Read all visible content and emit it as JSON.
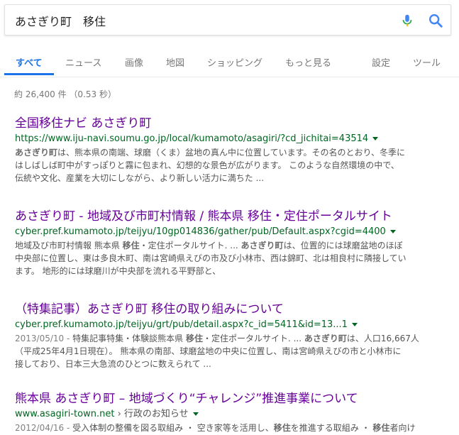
{
  "search": {
    "query": "あさぎり町　移住"
  },
  "tabs": [
    {
      "label": "すべて"
    },
    {
      "label": "ニュース"
    },
    {
      "label": "画像"
    },
    {
      "label": "地図"
    },
    {
      "label": "ショッピング"
    },
    {
      "label": "もっと見る"
    },
    {
      "label": "設定"
    },
    {
      "label": "ツール"
    }
  ],
  "stats": "約 26,400 件 （0.53 秒）",
  "results": [
    {
      "title": "全国移住ナビ あさぎり町",
      "url": "https://www.iju-navi.soumu.go.jp/local/kumamoto/asagiri/?cd_jichitai=43514",
      "snippet": {
        "l1_b": "あさぎり町",
        "l1": "は、熊本県の南端、球磨（くま）盆地の真ん中に位置しています。その名のとおり、冬季に",
        "l2": "はしばしば町中がすっぽりと霧に包まれ、幻想的な景色が広がります。 このような自然環境の中で、",
        "l3": "伝統や文化、産業を大切にしながら、より新しい活力に満ちた ..."
      }
    },
    {
      "title": "あさぎり町 - 地域及び市町村情報 / 熊本県 移住・定住ポータルサイト",
      "url": "cyber.pref.kumamoto.jp/teijyu/10gp014836/gather/pub/Default.aspx?cgid=4400",
      "snippet": {
        "l1_a": "地域及び市町村情報 熊本県 ",
        "l1_b1": "移住",
        "l1_c": "・定住ポータルサイト. ... ",
        "l1_b2": "あさぎり町",
        "l1_d": "は、位置的には球磨盆地のほぼ",
        "l2": "中央部に位置し、東は多良木町、南は宮崎県えびの市及び小林市、西は錦町、北は相良村に隣接してい",
        "l3": "ます。 地形的には球磨川が中央部を流れる平野部と、"
      }
    },
    {
      "title": "（特集記事）あさぎり町 移住の取り組みについて",
      "url": "cyber.pref.kumamoto.jp/teijyu/grt/pub/detail.aspx?c_id=5411&id=13...1",
      "snippet": {
        "date": "2013/05/10 - ",
        "l1_a": "特集記事特集・体験談熊本県 ",
        "l1_b1": "移住",
        "l1_c": "・定住ポータルサイト. ... ",
        "l1_b2": "あさぎり町",
        "l1_d": "は、人口16,667人",
        "l2": "（平成25年4月1日現在）。 熊本県の南部、球磨盆地の中央に位置し、南は宮崎県えびの市と小林市に",
        "l3": "接しており、日本三大急流のひとつに数えられて ..."
      }
    },
    {
      "title": "熊本県 あさぎり町 – 地域づくり“チャレンジ”推進事業について",
      "url": "www.asagiri-town.net",
      "crumb": " › 行政のお知らせ",
      "snippet": {
        "date": "2012/04/16 - ",
        "l1_a": "受入体制の整備を図る取組み ・ 空き家等を活用し、",
        "l1_b1": "移住",
        "l1_c": "を推進する取組み ・ ",
        "l1_b2": "移住",
        "l1_d": "者向け"
      }
    }
  ]
}
